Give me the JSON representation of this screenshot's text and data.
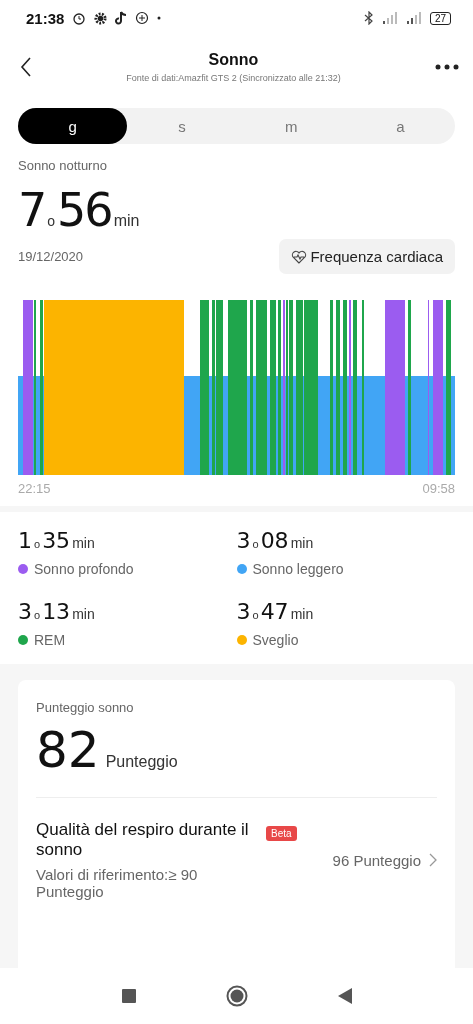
{
  "status_bar": {
    "time": "21:38",
    "battery": "27"
  },
  "header": {
    "title": "Sonno",
    "subtitle": "Fonte di dati:Amazfit GTS 2 (Sincronizzato alle 21:32)"
  },
  "tabs": [
    {
      "label": "g",
      "selected": true
    },
    {
      "label": "s",
      "selected": false
    },
    {
      "label": "m",
      "selected": false
    },
    {
      "label": "a",
      "selected": false
    }
  ],
  "summary": {
    "label": "Sonno notturno",
    "hours": "7",
    "hours_unit": "o",
    "minutes": "56",
    "minutes_unit": "min",
    "date": "19/12/2020",
    "heart_rate_button": "Frequenza cardiaca"
  },
  "chart": {
    "start": "22:15",
    "end": "09:58"
  },
  "stages": [
    {
      "hours": "1",
      "hours_unit": "o",
      "minutes": "35",
      "minutes_unit": "min",
      "name": "Sonno profondo",
      "color": "#9b5cf0"
    },
    {
      "hours": "3",
      "hours_unit": "o",
      "minutes": "08",
      "minutes_unit": "min",
      "name": "Sonno leggero",
      "color": "#41a5f5"
    },
    {
      "hours": "3",
      "hours_unit": "o",
      "minutes": "13",
      "minutes_unit": "min",
      "name": "REM",
      "color": "#1fa64c"
    },
    {
      "hours": "3",
      "hours_unit": "o",
      "minutes": "47",
      "minutes_unit": "min",
      "name": "Sveglio",
      "color": "#fcb400"
    }
  ],
  "score_card": {
    "label": "Punteggio sonno",
    "score": "82",
    "score_unit": "Punteggio",
    "breathing": {
      "title": "Qualità del respiro durante il sonno",
      "badge": "Beta",
      "reference": "Valori di riferimento:≥ 90 Punteggio",
      "value": "96 Punteggio"
    }
  }
}
